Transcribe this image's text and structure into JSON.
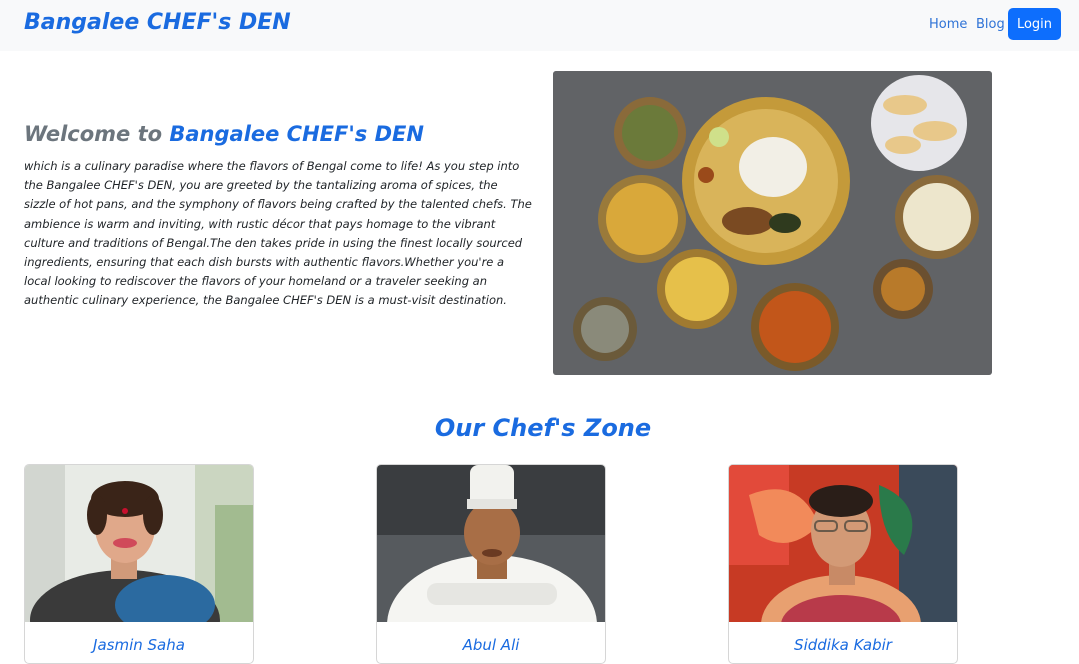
{
  "navbar": {
    "brand": "Bangalee CHEF's DEN",
    "links": [
      {
        "label": "Home"
      },
      {
        "label": "Blog"
      }
    ],
    "login_label": "Login"
  },
  "welcome": {
    "prefix": "Welcome to ",
    "brand": "Bangalee CHEF's DEN",
    "text": "which is a culinary paradise where the flavors of Bengal come to life! As you step into the Bangalee CHEF's DEN, you are greeted by the tantalizing aroma of spices, the sizzle of hot pans, and the symphony of flavors being crafted by the talented chefs. The ambience is warm and inviting, with rustic décor that pays homage to the vibrant culture and traditions of Bengal.The den takes pride in using the finest locally sourced ingredients, ensuring that each dish bursts with authentic flavors.Whether you're a local looking to rediscover the flavors of your homeland or a traveler seeking an authentic culinary experience, the Bangalee CHEF's DEN is a must-visit destination."
  },
  "zone": {
    "title": "Our Chef's Zone",
    "chefs": [
      {
        "name": "Jasmin Saha"
      },
      {
        "name": "Abul Ali"
      },
      {
        "name": "Siddika Kabir"
      }
    ]
  },
  "colors": {
    "brand": "#1a6be0",
    "primary_button": "#0d6efd",
    "navbar_bg": "#f8f9fa",
    "muted": "#6c757d"
  }
}
